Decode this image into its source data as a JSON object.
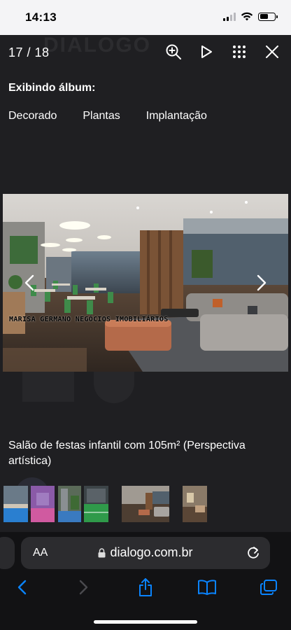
{
  "status_bar": {
    "time": "14:13",
    "battery_level": 0.55,
    "signal_bars_active": 2,
    "icons": [
      "signal-icon",
      "wifi-icon",
      "battery-icon"
    ]
  },
  "viewer": {
    "counter": "17 / 18",
    "actions": [
      "zoom-in-icon",
      "play-icon",
      "grid-icon",
      "close-icon"
    ],
    "album_label": "Exibindo álbum:",
    "tabs": [
      {
        "label": "Decorado"
      },
      {
        "label": "Plantas"
      },
      {
        "label": "Implantação"
      }
    ],
    "photo": {
      "watermark": "MARISA GERMANO NEGÓCIOS IMOBILIÁRIOS",
      "nav_prev_icon": "chevron-left-icon",
      "nav_next_icon": "chevron-right-icon"
    },
    "caption": "Salão de festas infantil com 105m² (Perspectiva artística)",
    "thumbnails_count": 6
  },
  "browser": {
    "text_size_label": "AA",
    "url": "dialogo.com.br",
    "lock_icon": "lock-icon",
    "reload_icon": "reload-icon",
    "toolbar": [
      "back-icon",
      "forward-icon",
      "share-icon",
      "bookmarks-icon",
      "tabs-icon"
    ]
  },
  "colors": {
    "accent": "#0a84ff",
    "viewer_background": "#1f1f22",
    "status_bar": "#f4f4f6"
  }
}
